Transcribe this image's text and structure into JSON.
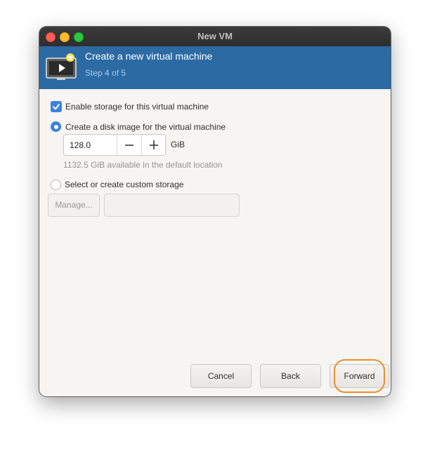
{
  "window": {
    "title": "New VM"
  },
  "header": {
    "title": "Create a new virtual machine",
    "step": "Step 4 of 5",
    "icon": "vm-monitor-icon"
  },
  "storage": {
    "enable_label": "Enable storage for this virtual machine",
    "enable_checked": true,
    "disk_image_label": "Create a disk image for the virtual machine",
    "disk_image_selected": true,
    "size_value": "128.0",
    "size_unit": "GiB",
    "available_hint": "1132.5 GiB available in the default location",
    "custom_label": "Select or create custom storage",
    "custom_selected": false,
    "manage_label": "Manage...",
    "custom_path_value": ""
  },
  "buttons": {
    "cancel": "Cancel",
    "back": "Back",
    "forward": "Forward"
  },
  "colors": {
    "header_bg": "#2c6aa4",
    "accent": "#3b84d8",
    "highlight": "#e8902e"
  }
}
